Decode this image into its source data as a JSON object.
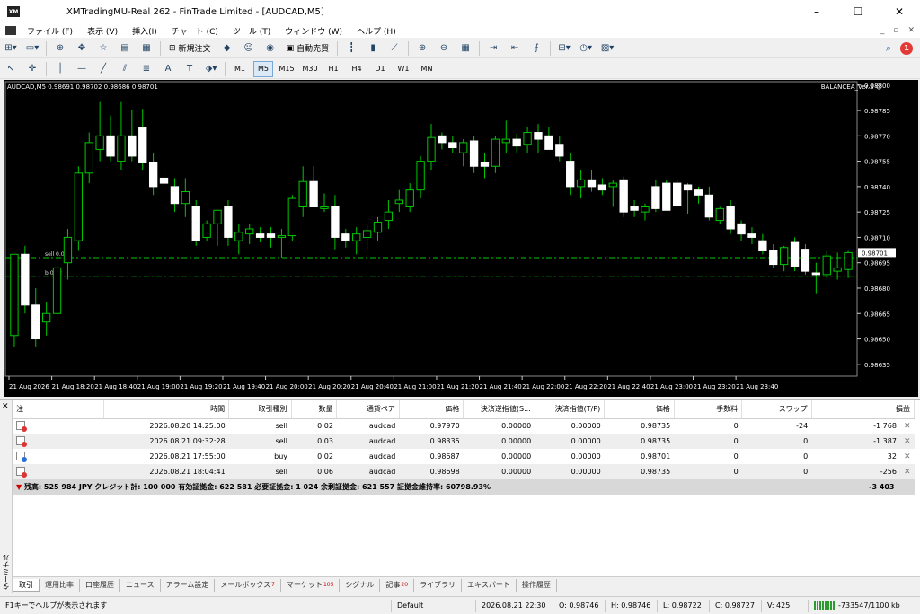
{
  "window": {
    "title": "XMTradingMU-Real 262 - FinTrade Limited - [AUDCAD,M5]",
    "logo_text": "XM",
    "controls": [
      "–",
      "☐",
      "✕"
    ]
  },
  "menu": {
    "items": [
      "ファイル (F)",
      "表示 (V)",
      "挿入(I)",
      "チャート (C)",
      "ツール (T)",
      "ウィンドウ (W)",
      "ヘルプ (H)"
    ],
    "mdi_controls": [
      "_",
      "▫",
      "✕"
    ]
  },
  "toolbar": {
    "new_order_label": "新規注文",
    "auto_trade_label": "自動売買",
    "timeframes": [
      "M1",
      "M5",
      "M15",
      "M30",
      "H1",
      "H4",
      "D1",
      "W1",
      "MN"
    ],
    "active_timeframe": "M5",
    "notification_count": "1"
  },
  "chart": {
    "symbol_info": "AUDCAD,M5  0.98691 0.98702 0.98686 0.98701",
    "ea_label": "BALANCEA_Ver.S ☺",
    "colors": {
      "background": "#000000",
      "candle_up": "#000000",
      "candle_down": "#ffffff",
      "wick": "#00c800",
      "level": "#00c800",
      "axis_text": "#ffffff"
    },
    "current_price": "0.98701",
    "level_labels": [
      "sell 0.03",
      "b 0.02"
    ]
  },
  "chart_data": {
    "type": "candlestick",
    "y_axis_ticks": [
      "0.98800",
      "0.98785",
      "0.98770",
      "0.98755",
      "0.98740",
      "0.98725",
      "0.98710",
      "0.98695",
      "0.98680",
      "0.98665",
      "0.98650",
      "0.98635"
    ],
    "ylim": [
      0.98628,
      0.98802
    ],
    "x_axis_ticks": [
      "21 Aug 2026",
      "21 Aug 18:20",
      "21 Aug 18:40",
      "21 Aug 19:00",
      "21 Aug 19:20",
      "21 Aug 19:40",
      "21 Aug 20:00",
      "21 Aug 20:20",
      "21 Aug 20:40",
      "21 Aug 21:00",
      "21 Aug 21:20",
      "21 Aug 21:40",
      "21 Aug 22:00",
      "21 Aug 22:20",
      "21 Aug 22:40",
      "21 Aug 23:00",
      "21 Aug 23:20",
      "21 Aug 23:40"
    ],
    "price_levels": [
      0.98698,
      0.98687
    ],
    "candles": [
      [
        0.98652,
        0.987,
        0.98645,
        0.987
      ],
      [
        0.987,
        0.98705,
        0.98665,
        0.9867
      ],
      [
        0.9867,
        0.9868,
        0.98645,
        0.9865
      ],
      [
        0.9866,
        0.98672,
        0.98652,
        0.98665
      ],
      [
        0.98665,
        0.987,
        0.98658,
        0.98692
      ],
      [
        0.98695,
        0.98715,
        0.98685,
        0.9871
      ],
      [
        0.98708,
        0.98752,
        0.98702,
        0.98748
      ],
      [
        0.98748,
        0.98772,
        0.98742,
        0.98766
      ],
      [
        0.98762,
        0.9879,
        0.98755,
        0.9877
      ],
      [
        0.9877,
        0.98782,
        0.98755,
        0.98758
      ],
      [
        0.98755,
        0.9879,
        0.9875,
        0.9877
      ],
      [
        0.9877,
        0.98785,
        0.98755,
        0.98758
      ],
      [
        0.98775,
        0.98786,
        0.9875,
        0.98754
      ],
      [
        0.98754,
        0.9876,
        0.98735,
        0.9874
      ],
      [
        0.98745,
        0.9875,
        0.98738,
        0.98742
      ],
      [
        0.9874,
        0.98745,
        0.98725,
        0.9873
      ],
      [
        0.9873,
        0.98745,
        0.98722,
        0.98737
      ],
      [
        0.98728,
        0.98732,
        0.98705,
        0.98708
      ],
      [
        0.9871,
        0.9872,
        0.98708,
        0.98718
      ],
      [
        0.98718,
        0.98725,
        0.98705,
        0.98726
      ],
      [
        0.98728,
        0.98732,
        0.98705,
        0.9871
      ],
      [
        0.98708,
        0.98718,
        0.987,
        0.98713
      ],
      [
        0.98712,
        0.98718,
        0.98706,
        0.98715
      ],
      [
        0.98712,
        0.98716,
        0.98707,
        0.9871
      ],
      [
        0.98712,
        0.98716,
        0.98704,
        0.9871
      ],
      [
        0.9871,
        0.98715,
        0.98698,
        0.98711
      ],
      [
        0.98711,
        0.98735,
        0.98708,
        0.98733
      ],
      [
        0.98728,
        0.98752,
        0.98722,
        0.98743
      ],
      [
        0.98743,
        0.98752,
        0.9873,
        0.98728
      ],
      [
        0.98727,
        0.98736,
        0.98725,
        0.98728
      ],
      [
        0.98728,
        0.98735,
        0.98703,
        0.9871
      ],
      [
        0.98712,
        0.98715,
        0.98704,
        0.98708
      ],
      [
        0.98708,
        0.98716,
        0.987,
        0.98712
      ],
      [
        0.9871,
        0.98718,
        0.98703,
        0.98714
      ],
      [
        0.98713,
        0.98722,
        0.98708,
        0.98719
      ],
      [
        0.9872,
        0.98732,
        0.98715,
        0.98725
      ],
      [
        0.9873,
        0.98738,
        0.98725,
        0.98732
      ],
      [
        0.98728,
        0.98742,
        0.98725,
        0.98738
      ],
      [
        0.98738,
        0.98758,
        0.98733,
        0.98755
      ],
      [
        0.98755,
        0.98777,
        0.9875,
        0.98769
      ],
      [
        0.9877,
        0.98772,
        0.98762,
        0.98766
      ],
      [
        0.98766,
        0.9877,
        0.9876,
        0.98763
      ],
      [
        0.9876,
        0.98768,
        0.98752,
        0.98766
      ],
      [
        0.98767,
        0.9877,
        0.98748,
        0.98752
      ],
      [
        0.98754,
        0.9876,
        0.98745,
        0.98752
      ],
      [
        0.98752,
        0.9877,
        0.98748,
        0.98768
      ],
      [
        0.98766,
        0.98779,
        0.9876,
        0.98768
      ],
      [
        0.98768,
        0.98771,
        0.9876,
        0.98764
      ],
      [
        0.98765,
        0.98775,
        0.9876,
        0.98772
      ],
      [
        0.98772,
        0.98777,
        0.9876,
        0.98768
      ],
      [
        0.9877,
        0.98775,
        0.98762,
        0.98762
      ],
      [
        0.98765,
        0.9877,
        0.98755,
        0.98758
      ],
      [
        0.98755,
        0.9876,
        0.98735,
        0.9874
      ],
      [
        0.9874,
        0.9875,
        0.98733,
        0.98744
      ],
      [
        0.98744,
        0.9875,
        0.98737,
        0.9874
      ],
      [
        0.98741,
        0.98745,
        0.98735,
        0.98738
      ],
      [
        0.9874,
        0.98744,
        0.98728,
        0.98742
      ],
      [
        0.98744,
        0.98746,
        0.98722,
        0.98725
      ],
      [
        0.98728,
        0.98732,
        0.98722,
        0.98726
      ],
      [
        0.98725,
        0.9873,
        0.9872,
        0.98728
      ],
      [
        0.9874,
        0.98744,
        0.98725,
        0.98727
      ],
      [
        0.98742,
        0.98744,
        0.98728,
        0.98726
      ],
      [
        0.98742,
        0.98744,
        0.98728,
        0.98729
      ],
      [
        0.98741,
        0.98742,
        0.98724,
        0.98738
      ],
      [
        0.98738,
        0.9874,
        0.9873,
        0.98735
      ],
      [
        0.98735,
        0.9874,
        0.9872,
        0.98722
      ],
      [
        0.9872,
        0.98728,
        0.98718,
        0.98727
      ],
      [
        0.98728,
        0.98732,
        0.98712,
        0.98715
      ],
      [
        0.98718,
        0.9872,
        0.98708,
        0.98712
      ],
      [
        0.98712,
        0.98716,
        0.98706,
        0.9871
      ],
      [
        0.98708,
        0.98712,
        0.987,
        0.98702
      ],
      [
        0.98702,
        0.98706,
        0.98692,
        0.98694
      ],
      [
        0.98694,
        0.98705,
        0.9869,
        0.98704
      ],
      [
        0.98707,
        0.9871,
        0.9869,
        0.98693
      ],
      [
        0.98703,
        0.98706,
        0.98688,
        0.9869
      ],
      [
        0.98689,
        0.98695,
        0.98677,
        0.98688
      ],
      [
        0.98688,
        0.98702,
        0.98686,
        0.98699
      ],
      [
        0.9869,
        0.98701,
        0.98685,
        0.98692
      ],
      [
        0.98691,
        0.98702,
        0.98686,
        0.98701
      ]
    ]
  },
  "terminal": {
    "side_label": "ターミナル",
    "headers": [
      "注",
      "時間",
      "取引種別",
      "数量",
      "通貨ペア",
      "価格",
      "決済逆指値(S...",
      "決済指値(T/P)",
      "価格",
      "手数料",
      "スワップ",
      "損益"
    ],
    "rows": [
      {
        "icon": "sell",
        "time": "2026.08.20 14:25:00",
        "type": "sell",
        "volume": "0.02",
        "pair": "audcad",
        "price": "0.97970",
        "sl": "0.00000",
        "tp": "0.00000",
        "cur": "0.98735",
        "commission": "0",
        "swap": "-24",
        "profit": "-1 768"
      },
      {
        "icon": "sell",
        "time": "2026.08.21 09:32:28",
        "type": "sell",
        "volume": "0.03",
        "pair": "audcad",
        "price": "0.98335",
        "sl": "0.00000",
        "tp": "0.00000",
        "cur": "0.98735",
        "commission": "0",
        "swap": "0",
        "profit": "-1 387"
      },
      {
        "icon": "buy",
        "time": "2026.08.21 17:55:00",
        "type": "buy",
        "volume": "0.02",
        "pair": "audcad",
        "price": "0.98687",
        "sl": "0.00000",
        "tp": "0.00000",
        "cur": "0.98701",
        "commission": "0",
        "swap": "0",
        "profit": "32"
      },
      {
        "icon": "sell",
        "time": "2026.08.21 18:04:41",
        "type": "sell",
        "volume": "0.06",
        "pair": "audcad",
        "price": "0.98698",
        "sl": "0.00000",
        "tp": "0.00000",
        "cur": "0.98735",
        "commission": "0",
        "swap": "0",
        "profit": "-256"
      }
    ],
    "close_glyph": "✕",
    "summary_text": "残高: 525 984 JPY  クレジット計: 100 000  有効証拠金: 622 581  必要証拠金: 1 024  余剰証拠金: 621 557  証拠金維持率: 60798.93%",
    "summary_total": "-3 403"
  },
  "tabs": [
    {
      "label": "取引",
      "badge": "",
      "active": true
    },
    {
      "label": "運用比率",
      "badge": ""
    },
    {
      "label": "口座履歴",
      "badge": ""
    },
    {
      "label": "ニュース",
      "badge": ""
    },
    {
      "label": "アラーム設定",
      "badge": ""
    },
    {
      "label": "メールボックス",
      "badge": "7"
    },
    {
      "label": "マーケット",
      "badge": "105"
    },
    {
      "label": "シグナル",
      "badge": ""
    },
    {
      "label": "記事",
      "badge": "20"
    },
    {
      "label": "ライブラリ",
      "badge": ""
    },
    {
      "label": "エキスパート",
      "badge": ""
    },
    {
      "label": "操作履歴",
      "badge": ""
    }
  ],
  "status": {
    "help": "F1キーでヘルプが表示されます",
    "profile": "Default",
    "datetime": "2026.08.21 22:30",
    "open": "O: 0.98746",
    "high": "H: 0.98746",
    "low": "L: 0.98722",
    "close": "C: 0.98727",
    "volume": "V: 425",
    "traffic": "-733547/1100 kb"
  }
}
